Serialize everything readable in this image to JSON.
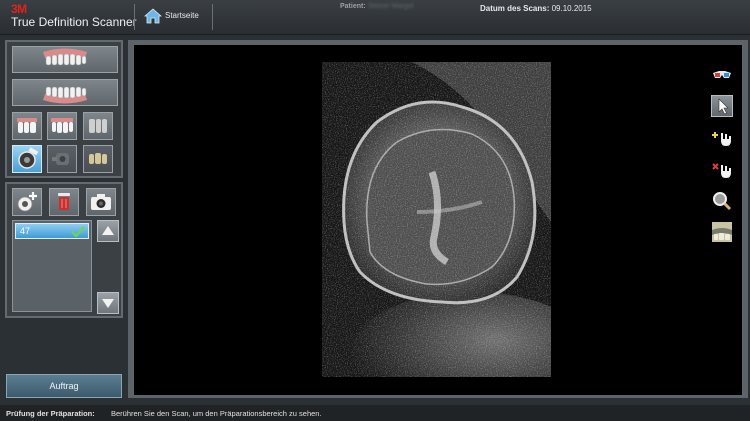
{
  "header": {
    "brand": "3M",
    "app_title": "True Definition Scanner",
    "home_label": "Startseite",
    "patient_label": "Patient:",
    "patient_name": "Steiner Margot",
    "scan_date_label": "Datum des Scans:",
    "scan_date_value": "09.10.2015"
  },
  "scan_list": {
    "items": [
      {
        "label": "47",
        "checked": true
      }
    ]
  },
  "order_button": {
    "label": "Auftrag"
  },
  "status": {
    "title": "Prüfung der Präparation:",
    "message": "Berühren Sie den Scan, um den Präparationsbereich zu sehen."
  },
  "colors": {
    "accent_blue": "#4aa0d6",
    "brand_red": "#e2231a",
    "viewport_bg": "#000000"
  },
  "icons": {
    "home": "home-icon",
    "upper_arch": "upper-arch-icon",
    "lower_arch": "lower-arch-icon",
    "add_scan": "add-scan-icon",
    "delete": "trash-icon",
    "camera": "camera-icon",
    "view_3d": "3d-glasses-icon",
    "select": "cursor-icon",
    "add_area": "add-hand-icon",
    "remove_area": "remove-hand-icon",
    "magnify": "magnifier-icon",
    "thumbnail": "scan-thumbnail-icon"
  }
}
